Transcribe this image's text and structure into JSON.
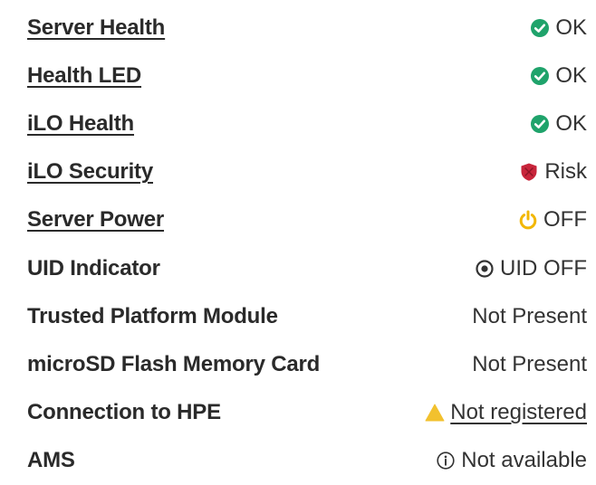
{
  "colors": {
    "ok": "#1fa36b",
    "risk": "#c8253b",
    "power": "#f2b705",
    "warning": "#f2c12e",
    "text": "#2c2c2c"
  },
  "rows": [
    {
      "label": "Server Health",
      "status_icon": "check-circle-icon",
      "value": "OK"
    },
    {
      "label": "Health LED",
      "status_icon": "check-circle-icon",
      "value": "OK"
    },
    {
      "label": "iLO Health",
      "status_icon": "check-circle-icon",
      "value": "OK"
    },
    {
      "label": "iLO Security",
      "status_icon": "shield-risk-icon",
      "value": "Risk"
    },
    {
      "label": "Server Power",
      "status_icon": "power-icon",
      "value": "OFF"
    },
    {
      "label": "UID Indicator",
      "status_icon": "uid-target-icon",
      "value": "UID OFF"
    },
    {
      "label": "Trusted Platform Module",
      "value": "Not Present"
    },
    {
      "label": "microSD Flash Memory Card",
      "value": "Not Present"
    },
    {
      "label": "Connection to HPE",
      "status_icon": "warning-triangle-icon",
      "value": "Not registered"
    },
    {
      "label": "AMS",
      "status_icon": "info-circle-icon",
      "value": "Not available"
    }
  ]
}
